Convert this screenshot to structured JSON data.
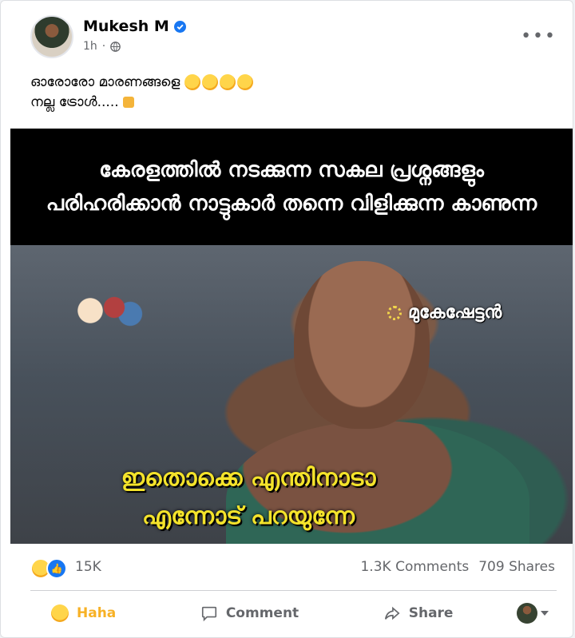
{
  "post": {
    "author": "Mukesh M",
    "time": "1h",
    "caption_line1": "ഓരോരോ മാരണങ്ങളെ",
    "caption_line2": "നല്ല ട്രോൾ.....",
    "emojis": [
      "rolling-on-floor-laughing-emoji",
      "rolling-on-floor-laughing-emoji",
      "rolling-on-floor-laughing-emoji",
      "rolling-on-floor-laughing-emoji"
    ],
    "point_emoji": "backhand-index-pointing-down-emoji"
  },
  "meme": {
    "top_text": "കേരളത്തിൽ നടക്കുന്ന സകല പ്രശ്നങ്ങളും പരിഹരിക്കാൻ നാട്ടുകാർ തന്നെ വിളിക്കുന്ന കാണുന്ന",
    "tag": "മുകേഷേട്ടൻ",
    "bottom_line1": "ഇതൊക്കെ എന്തിനാടാ",
    "bottom_line2": "എന്നോട് പറയുന്നേ"
  },
  "stats": {
    "reactions": "15K",
    "comments": "1.3K Comments",
    "shares": "709 Shares"
  },
  "actions": {
    "haha": "Haha",
    "comment": "Comment",
    "share": "Share"
  },
  "colors": {
    "facebook_blue": "#1877f2",
    "haha_yellow": "#f7b125",
    "meme_yellow": "#f4e32b"
  }
}
